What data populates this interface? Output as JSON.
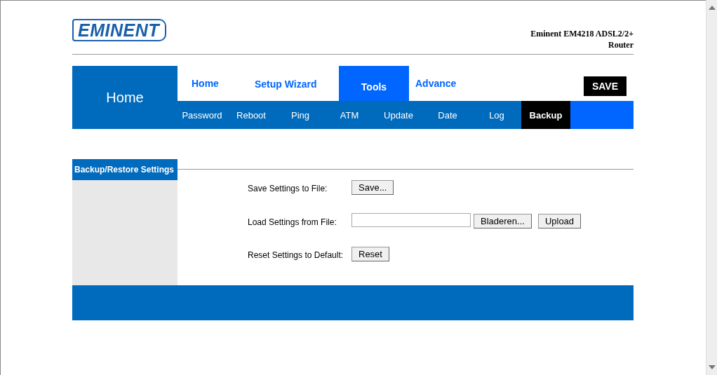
{
  "logo": "EMINENT",
  "product_title": [
    "Eminent EM4218 ADSL2/2+",
    "Router"
  ],
  "section": "Home",
  "main_tabs": [
    {
      "label": "Home",
      "selected": false
    },
    {
      "label": "Setup Wizard",
      "selected": false
    },
    {
      "label": "Tools",
      "selected": true
    },
    {
      "label": "Advance",
      "selected": false
    }
  ],
  "save_button": "SAVE",
  "sub_tabs": [
    {
      "label": "Password",
      "selected": false
    },
    {
      "label": "Reboot",
      "selected": false
    },
    {
      "label": "Ping",
      "selected": false
    },
    {
      "label": "ATM",
      "selected": false
    },
    {
      "label": "Update",
      "selected": false
    },
    {
      "label": "Date",
      "selected": false
    },
    {
      "label": "Log",
      "selected": false
    },
    {
      "label": "Backup",
      "selected": true
    }
  ],
  "sidebar": {
    "title": "Backup/Restore Settings"
  },
  "rows": [
    {
      "kind": "button",
      "label": "Save Settings to File:",
      "buttons": [
        "Save..."
      ]
    },
    {
      "kind": "file",
      "label": "Load Settings from File:",
      "buttons": [
        "Bladeren...",
        "Upload"
      ]
    },
    {
      "kind": "button",
      "label": "Reset Settings to Default:",
      "buttons": [
        "Reset"
      ]
    }
  ]
}
